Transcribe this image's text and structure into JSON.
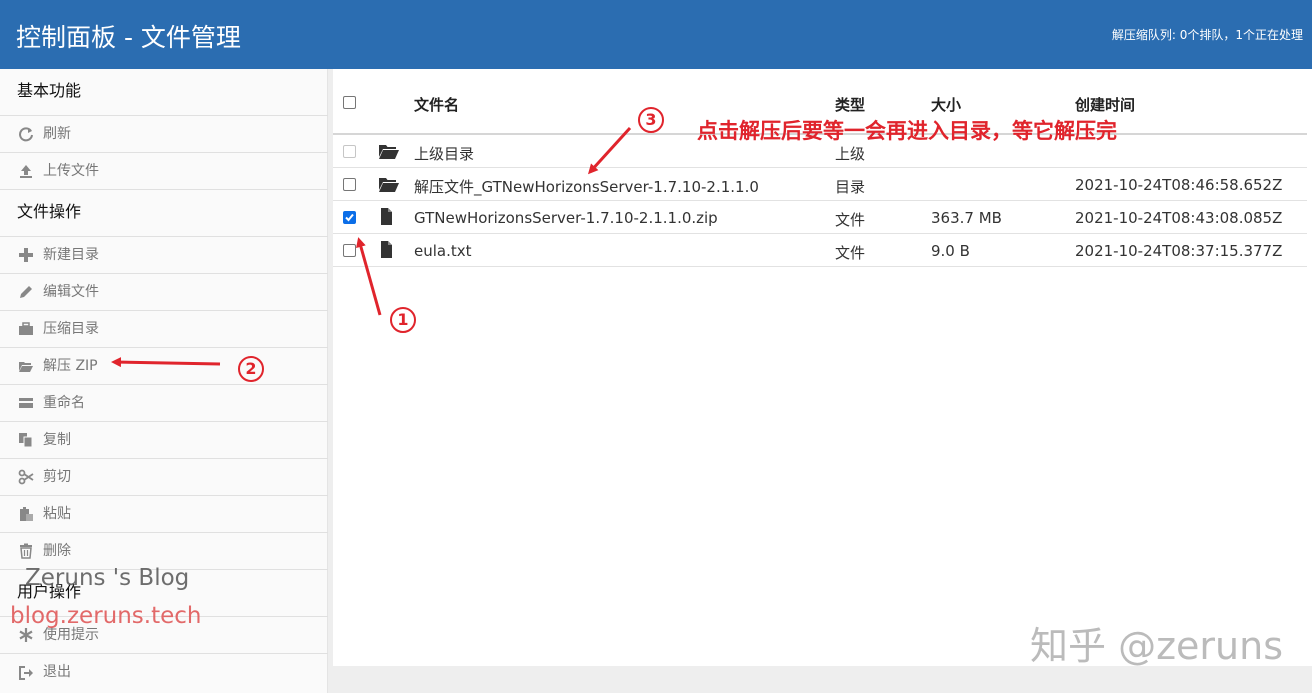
{
  "header": {
    "title": "控制面板 - 文件管理",
    "queue_status": "解压缩队列: 0个排队，1个正在处理"
  },
  "sidebar": {
    "section_basic": "基本功能",
    "refresh": "刷新",
    "upload": "上传文件",
    "section_file_ops": "文件操作",
    "new_dir": "新建目录",
    "edit_file": "编辑文件",
    "compress_dir": "压缩目录",
    "unzip": "解压 ZIP",
    "rename": "重命名",
    "copy": "复制",
    "cut": "剪切",
    "paste": "粘贴",
    "delete": "删除",
    "section_user_ops": "用户操作",
    "tips": "使用提示",
    "logout": "退出"
  },
  "table": {
    "headers": {
      "name": "文件名",
      "type": "类型",
      "size": "大小",
      "created": "创建时间"
    },
    "rows": [
      {
        "name": "上级目录",
        "type": "上级",
        "size": "",
        "created": "",
        "icon": "folder-open-icon",
        "checked": false,
        "disabled": true
      },
      {
        "name": "解压文件_GTNewHorizonsServer-1.7.10-2.1.1.0",
        "type": "目录",
        "size": "",
        "created": "2021-10-24T08:46:58.652Z",
        "icon": "folder-open-icon",
        "checked": false,
        "disabled": false
      },
      {
        "name": "GTNewHorizonsServer-1.7.10-2.1.1.0.zip",
        "type": "文件",
        "size": "363.7 MB",
        "created": "2021-10-24T08:43:08.085Z",
        "icon": "file-icon",
        "checked": true,
        "disabled": false
      },
      {
        "name": "eula.txt",
        "type": "文件",
        "size": "9.0 B",
        "created": "2021-10-24T08:37:15.377Z",
        "icon": "file-icon",
        "checked": false,
        "disabled": false
      }
    ]
  },
  "annotations": {
    "note": "点击解压后要等一会再进入目录，等它解压完",
    "step1": "1",
    "step2": "2",
    "step3": "3",
    "color": "#e0242c"
  },
  "watermarks": {
    "blog_name": "Zeruns 's Blog",
    "blog_url": "blog.zeruns.tech",
    "zhihu": "知乎 @zeruns"
  },
  "colors": {
    "header_bg": "#2b6db1",
    "checkbox_checked": "#0b6ee8"
  }
}
